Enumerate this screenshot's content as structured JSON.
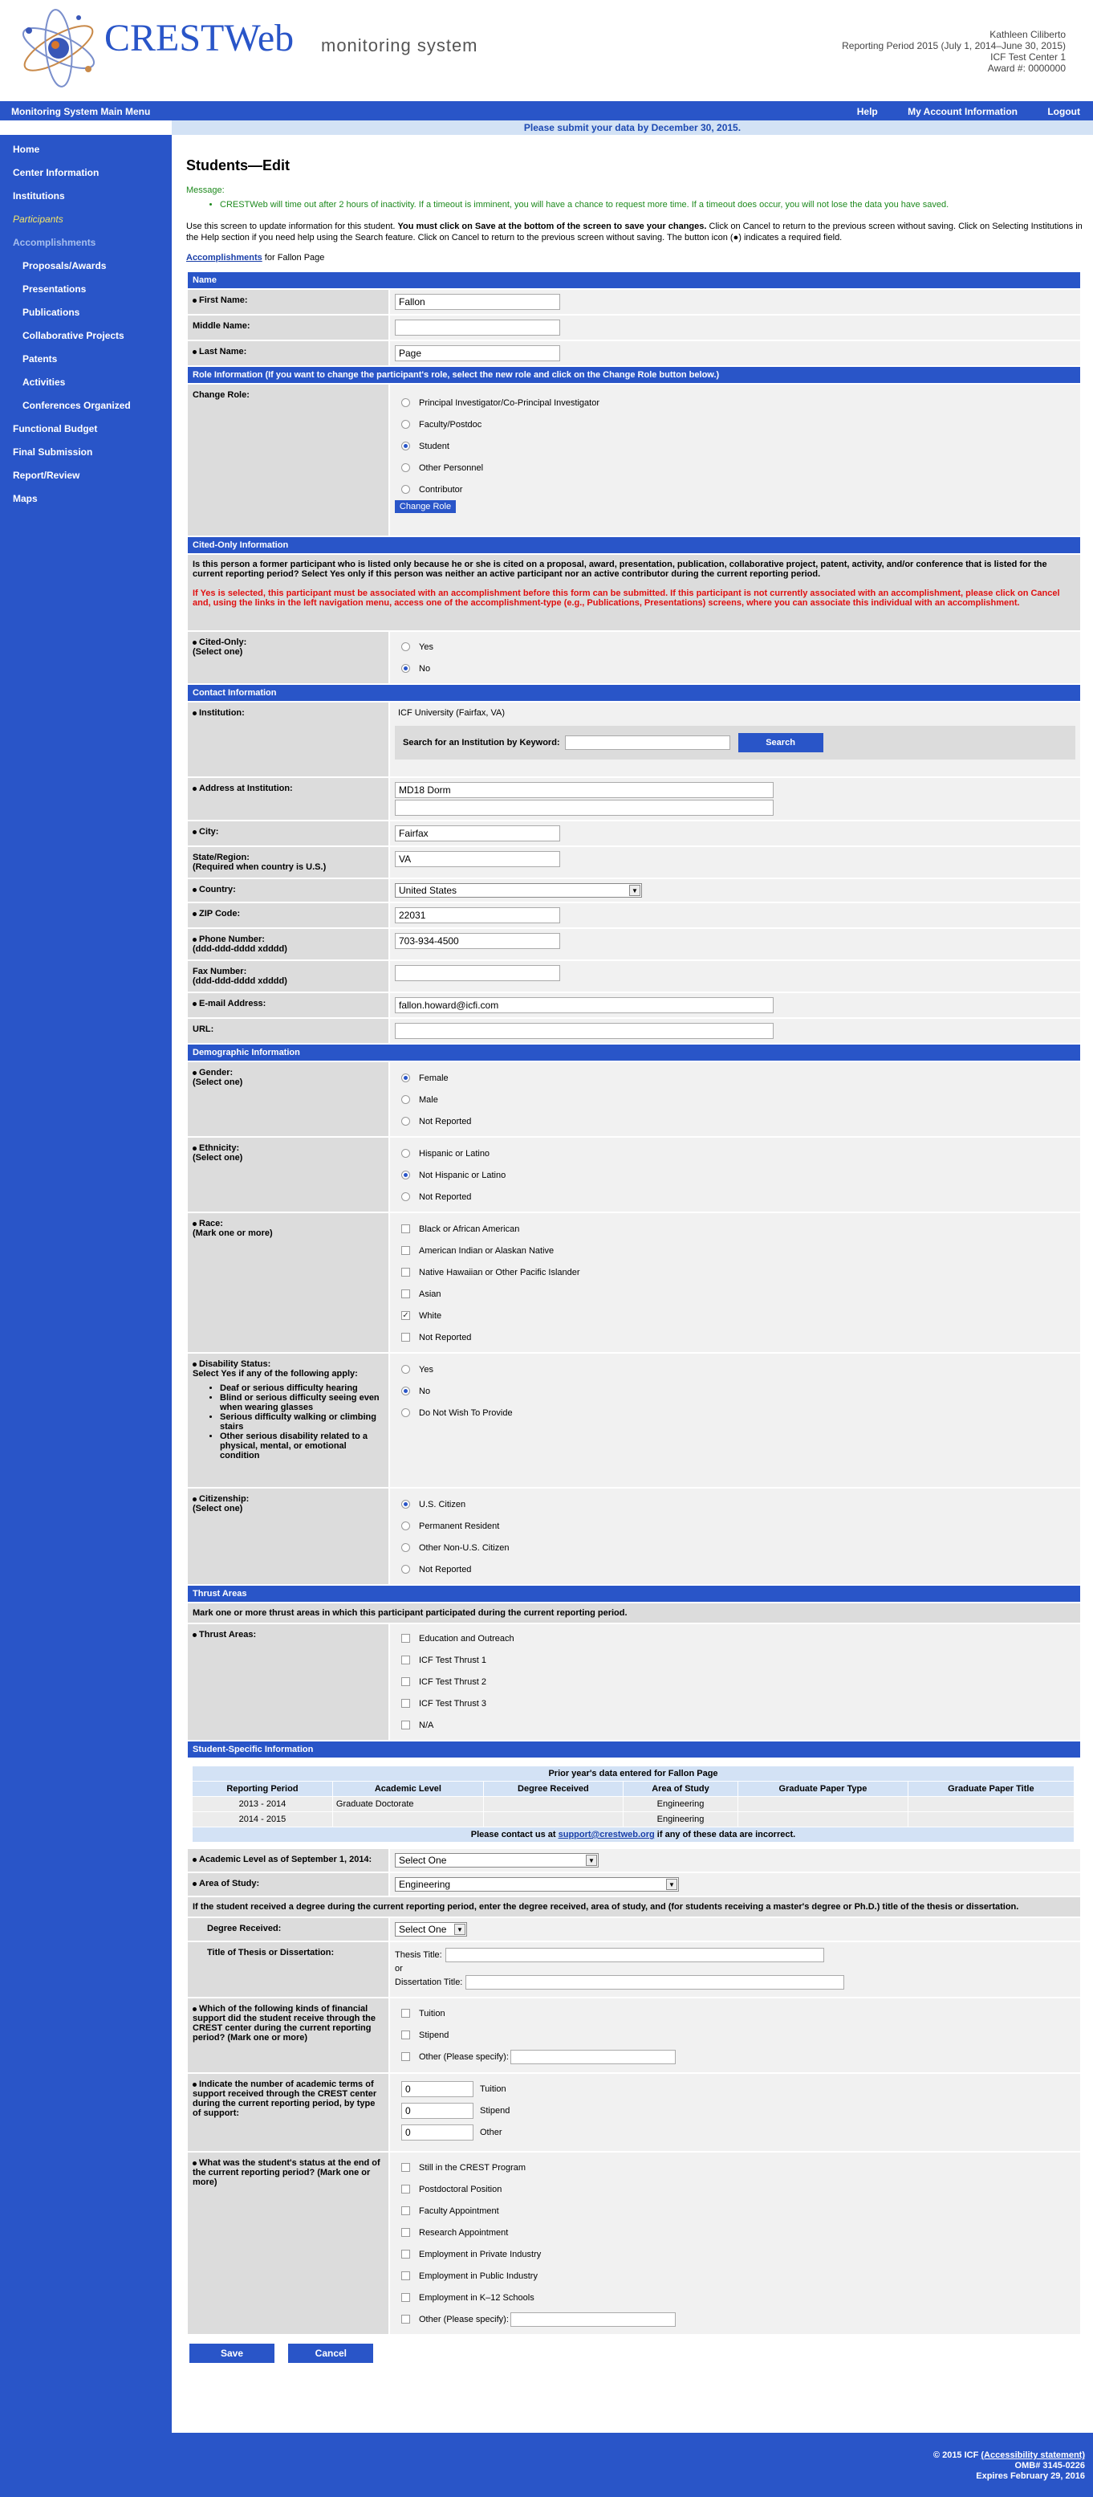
{
  "header": {
    "brand": "CRESTWeb",
    "tagline": "monitoring system",
    "user_lines": [
      "Kathleen Ciliberto",
      "Reporting Period 2015 (July 1, 2014–June 30, 2015)",
      "ICF Test Center 1",
      "Award #: 0000000"
    ]
  },
  "topnav": {
    "main_menu": "Monitoring System Main Menu",
    "help": "Help",
    "account": "My Account Information",
    "logout": "Logout"
  },
  "deadline": "Please submit your data by December 30, 2015.",
  "sidebar": {
    "home": "Home",
    "center_info": "Center Information",
    "institutions": "Institutions",
    "participants": "Participants",
    "accomplishments": "Accomplishments",
    "proposals": "Proposals/Awards",
    "presentations": "Presentations",
    "publications": "Publications",
    "collab": "Collaborative Projects",
    "patents": "Patents",
    "activities": "Activities",
    "conferences": "Conferences Organized",
    "budget": "Functional Budget",
    "final": "Final Submission",
    "report": "Report/Review",
    "maps": "Maps"
  },
  "page": {
    "title": "Students—Edit",
    "message_label": "Message:",
    "message": "CRESTWeb will time out after 2 hours of inactivity. If a timeout is imminent, you will have a chance to request more time. If a timeout does occur, you will not lose the data you have saved.",
    "instr_1": "Use this screen to update information for this student. ",
    "instr_2": "You must click on Save at the bottom of the screen to save your changes.",
    "instr_3": " Click on Cancel to return to the previous screen without saving. Click on Selecting Institutions in the Help section if you need help using the Search feature. Click on Cancel to return to the previous screen without saving. The button icon (●) indicates a required field.",
    "crumb_link": "Accomplishments",
    "crumb_rest": " for Fallon Page"
  },
  "name": {
    "header": "Name",
    "first_label": "First Name:",
    "first_value": "Fallon",
    "middle_label": "Middle Name:",
    "middle_value": "",
    "last_label": "Last Name:",
    "last_value": "Page"
  },
  "role": {
    "header": "Role Information (If you want to change the participant's role, select the new role and click on the Change Role button below.)",
    "label": "Change Role:",
    "options": [
      "Principal Investigator/Co-Principal Investigator",
      "Faculty/Postdoc",
      "Student",
      "Other Personnel",
      "Contributor"
    ],
    "selected": "Student",
    "button": "Change Role"
  },
  "cited": {
    "header": "Cited-Only Information",
    "question": "Is this person a former participant who is listed only because he or she is cited on a proposal, award, presentation, publication, collaborative project, patent, activity, and/or conference that is listed for the current reporting period? Select Yes only if this person was neither an active participant nor an active contributor during the current reporting period.",
    "warning": "If Yes is selected, this participant must be associated with an accomplishment before this form can be submitted. If this participant is not currently associated with an accomplishment, please click on Cancel and, using the links in the left navigation menu, access one of the accomplishment-type (e.g., Publications, Presentations) screens, where you can associate this individual with an accomplishment.",
    "label_1": "Cited-Only:",
    "label_2": "(Select one)",
    "yes": "Yes",
    "no": "No",
    "selected": "No"
  },
  "contact": {
    "header": "Contact Information",
    "institution_label": "Institution:",
    "institution_value": "ICF University (Fairfax, VA)",
    "search_label": "Search for an Institution by Keyword:",
    "search_button": "Search",
    "address_label": "Address at Institution:",
    "address_1": "MD18 Dorm",
    "address_2": "",
    "city_label": "City:",
    "city_value": "Fairfax",
    "state_label_1": "State/Region:",
    "state_label_2": "(Required when country is U.S.)",
    "state_value": "VA",
    "country_label": "Country:",
    "country_value": "United States",
    "zip_label": "ZIP Code:",
    "zip_value": "22031",
    "phone_label_1": "Phone Number:",
    "phone_label_2": "(ddd-ddd-dddd xdddd)",
    "phone_value": "703-934-4500",
    "fax_label_1": "Fax Number:",
    "fax_label_2": "(ddd-ddd-dddd xdddd)",
    "fax_value": "",
    "email_label": "E-mail Address:",
    "email_value": "fallon.howard@icfi.com",
    "url_label": "URL:",
    "url_value": ""
  },
  "demo": {
    "header": "Demographic Information",
    "gender_label_1": "Gender:",
    "gender_label_2": "(Select one)",
    "gender_options": [
      "Female",
      "Male",
      "Not Reported"
    ],
    "gender_selected": "Female",
    "eth_label_1": "Ethnicity:",
    "eth_label_2": "(Select one)",
    "eth_options": [
      "Hispanic or Latino",
      "Not Hispanic or Latino",
      "Not Reported"
    ],
    "eth_selected": "Not Hispanic or Latino",
    "race_label_1": "Race:",
    "race_label_2": "(Mark one or more)",
    "race_options": [
      "Black or African American",
      "American Indian or Alaskan Native",
      "Native Hawaiian or Other Pacific Islander",
      "Asian",
      "White",
      "Not Reported"
    ],
    "race_checked": [
      "White"
    ],
    "dis_label_1": "Disability Status:",
    "dis_label_2": "Select Yes if any of the following apply:",
    "dis_items": [
      "Deaf or serious difficulty hearing",
      "Blind or serious difficulty seeing even when wearing glasses",
      "Serious difficulty walking or climbing stairs",
      "Other serious disability related to a physical, mental, or emotional condition"
    ],
    "dis_options": [
      "Yes",
      "No",
      "Do Not Wish To Provide"
    ],
    "dis_selected": "No",
    "cit_label_1": "Citizenship:",
    "cit_label_2": "(Select one)",
    "cit_options": [
      "U.S. Citizen",
      "Permanent Resident",
      "Other Non-U.S. Citizen",
      "Not Reported"
    ],
    "cit_selected": "U.S. Citizen"
  },
  "thrust": {
    "header": "Thrust Areas",
    "instr": "Mark one or more thrust areas in which this participant participated during the current reporting period.",
    "label": "Thrust Areas:",
    "options": [
      "Education and Outreach",
      "ICF Test Thrust 1",
      "ICF Test Thrust 2",
      "ICF Test Thrust 3",
      "N/A"
    ]
  },
  "student": {
    "header": "Student-Specific Information",
    "prior_title": "Prior year's data entered for Fallon Page",
    "prior_cols": [
      "Reporting Period",
      "Academic Level",
      "Degree Received",
      "Area of Study",
      "Graduate Paper Type",
      "Graduate Paper Title"
    ],
    "prior_rows": [
      [
        "2013 - 2014",
        "Graduate Doctorate",
        "",
        "Engineering",
        "",
        ""
      ],
      [
        "2014 - 2015",
        "",
        "",
        "Engineering",
        "",
        ""
      ]
    ],
    "contact_pre": "Please contact us at ",
    "contact_link": "support@crestweb.org",
    "contact_post": " if any of these data are incorrect.",
    "level_label": "Academic Level as of September 1, 2014:",
    "level_value": "Select One",
    "area_label": "Area of Study:",
    "area_value": "Engineering",
    "degree_instr": "If the student received a degree during the current reporting period, enter the degree received, area of study, and (for students receiving a master's degree or Ph.D.) title of the thesis or dissertation.",
    "degree_label": "Degree Received:",
    "degree_value": "Select One",
    "title_label": "Title of Thesis or Dissertation:",
    "thesis_label": "Thesis Title:",
    "or_label": "or",
    "diss_label": "Dissertation Title:",
    "support_label": "Which of the following kinds of financial support did the student receive through the CREST center during the current reporting period? (Mark one or more)",
    "support_options": [
      "Tuition",
      "Stipend",
      "Other (Please specify):"
    ],
    "terms_label": "Indicate the number of academic terms of support received through the CREST center during the current reporting period, by type of support:",
    "terms_rows": [
      {
        "value": "0",
        "label": "Tuition"
      },
      {
        "value": "0",
        "label": "Stipend"
      },
      {
        "value": "0",
        "label": "Other"
      }
    ],
    "status_label": "What was the student's status at the end of the current reporting period? (Mark one or more)",
    "status_options": [
      "Still in the CREST Program",
      "Postdoctoral Position",
      "Faculty Appointment",
      "Research Appointment",
      "Employment in Private Industry",
      "Employment in Public Industry",
      "Employment in K–12 Schools",
      "Other (Please specify):"
    ]
  },
  "actions": {
    "save": "Save",
    "cancel": "Cancel"
  },
  "footer": {
    "line1": "© 2015 ICF ",
    "line1_link": "(Accessibility statement)",
    "line2": "OMB# 3145-0226",
    "line3": "Expires February 29, 2016"
  },
  "colors": {
    "primary": "#2955c8",
    "label_bg": "#dcdcdc",
    "value_bg": "#f1f1f1",
    "message": "#1e8a1e",
    "warning": "#e01010",
    "active_nav": "#f2e56b"
  }
}
